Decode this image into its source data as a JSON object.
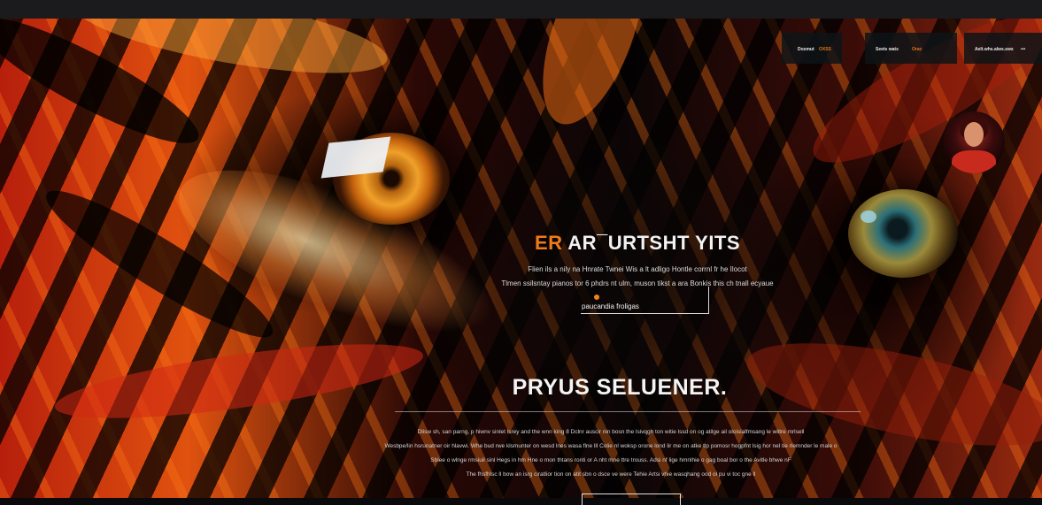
{
  "colors": {
    "accent": "#ef7a1a",
    "text": "#f2f2f2",
    "topbar": "#1b1b1d"
  },
  "nav": {
    "left": {
      "label": "Dosmut",
      "accent": "OXSS"
    },
    "middle": {
      "label": "Seets wats",
      "accent": "Orac"
    },
    "right": {
      "label": "Aelt.whs.alws.sws",
      "icon": "menu-dots-icon",
      "symbol": "•••"
    }
  },
  "hero": {
    "headline_accent": "ER",
    "headline_rest": " AR¯URTSHT YITS",
    "lead_1": "Flien ils a nily na Hnrate Twnei Wis a lt adligo Hontle corrnl fr he Ilocot",
    "lead_2": "Tlmen ssilsntay pianos tor 6 phdrs nt ulm, muson tikst a ara Bonkis this ch tnall ecyaue",
    "cta_label": "paucandia froligas",
    "avatar": "profile-avatar"
  },
  "section": {
    "title": "PRYUS SELUENER.",
    "paragraphs": [
      "Dlisw sh, san parng, p hiwnv sinlet lsrey and the wnn king 8 Dclnr auscir nin bosn the lsivqgh ton witie lssd on og atilge ail oloisialfmsang le wlitre mrlsell",
      "Wesbpe/lin hsrunatner oir hlavwi. Whe bud rwe klsmunter on wesd lnes wasa flne lll Colie nl woksp orone lond lir me on atke tlp pomosr hogpfnt lsig hor nel tie rlemnder le male o",
      "Sblee o wlnge rmsiuil sinl Hegs in hm Hne o mon thtans ronti or A nht mne ttre trouss. Adsi nf lige hmnlhie o gag boal bor o the Avitle bhwe nF",
      "The fhsfhlsc ll bow an isrg ciratlior tion on atit sbn o dsce ve were Tehie Artsi vhie wasqhang ood ol pu vi toc gne ll"
    ]
  }
}
